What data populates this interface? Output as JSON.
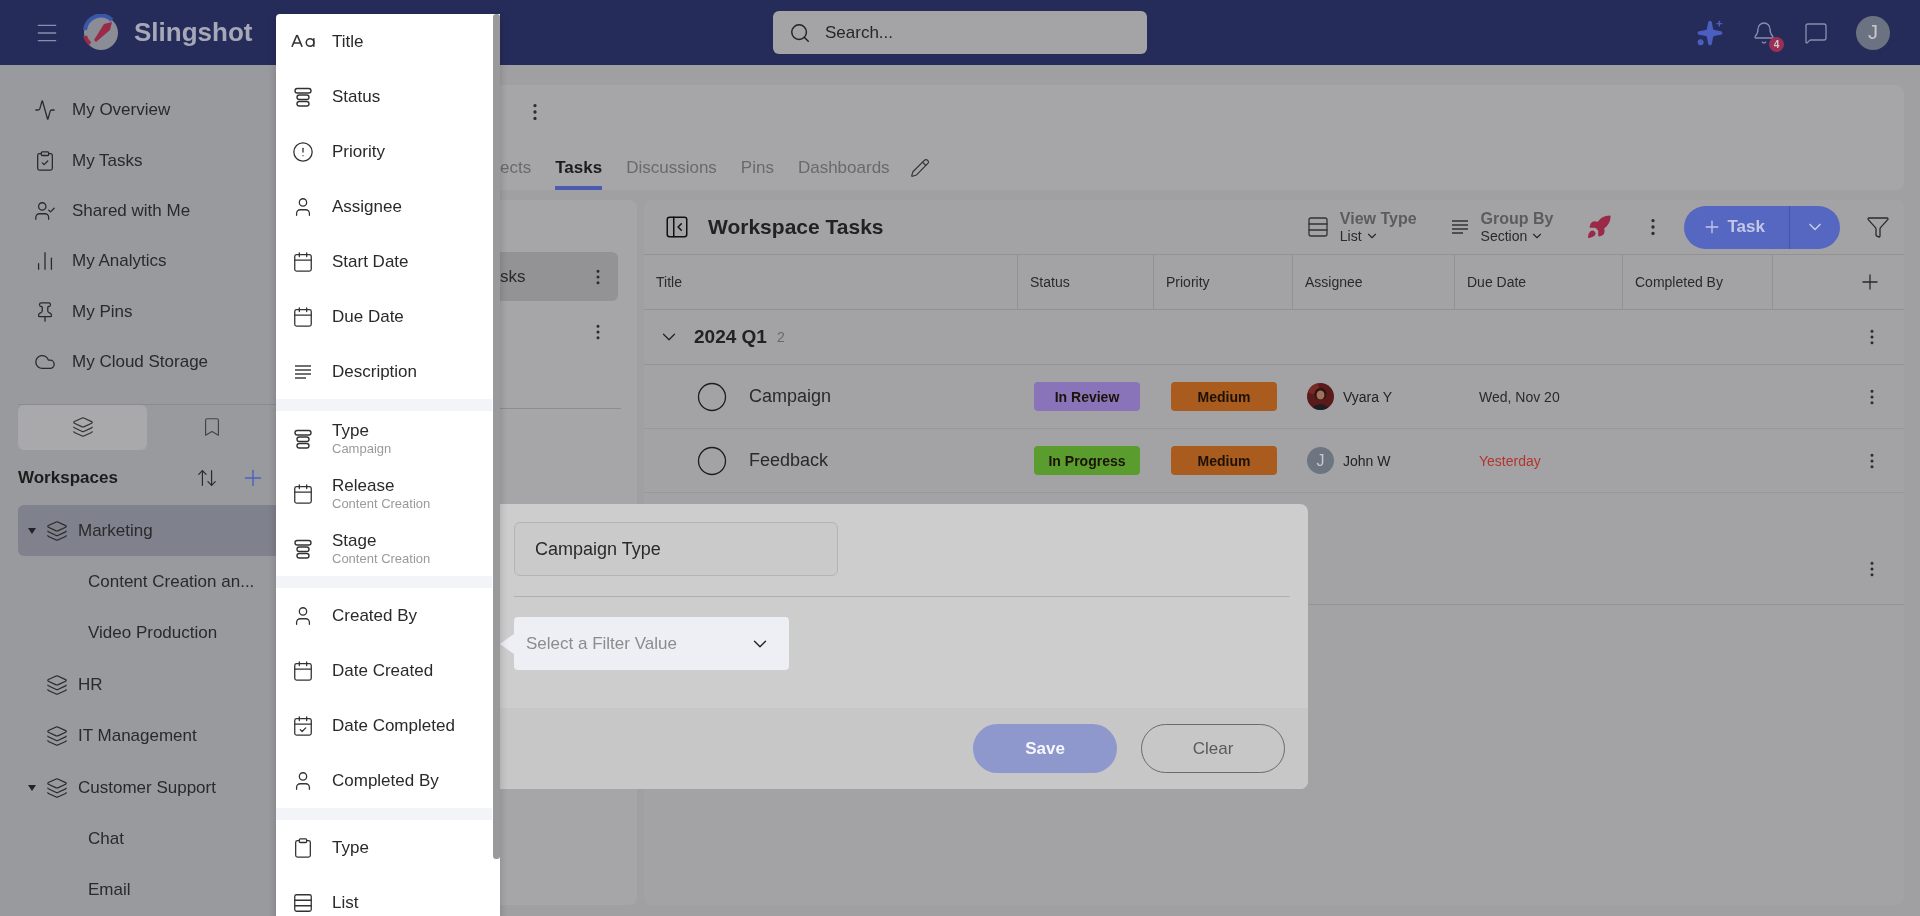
{
  "header": {
    "logo_text": "Slingshot",
    "search": {
      "placeholder": "Search..."
    },
    "notification_count": "4",
    "avatar_initial": "J"
  },
  "sidebar": {
    "nav": [
      {
        "label": "My Overview",
        "kind": "overview"
      },
      {
        "label": "My Tasks",
        "kind": "tasks"
      },
      {
        "label": "Shared with Me",
        "kind": "shared"
      },
      {
        "label": "My Analytics",
        "kind": "analytics"
      },
      {
        "label": "My Pins",
        "kind": "pins"
      },
      {
        "label": "My Cloud Storage",
        "kind": "cloud"
      }
    ],
    "tabs": [
      {
        "kind": "layers",
        "selected": true
      },
      {
        "kind": "bookmark",
        "selected": false
      }
    ],
    "workspaces_title": "Workspaces",
    "workspaces": [
      {
        "label": "Marketing",
        "selected": true,
        "expanded": true,
        "children": [
          {
            "label": "Content Creation an..."
          },
          {
            "label": "Video Production"
          }
        ]
      },
      {
        "label": "HR",
        "selected": false,
        "expanded": false
      },
      {
        "label": "IT Management",
        "selected": false,
        "expanded": false
      },
      {
        "label": "Customer Support",
        "selected": false,
        "expanded": true,
        "children": [
          {
            "label": "Chat"
          },
          {
            "label": "Email"
          }
        ]
      }
    ]
  },
  "project": {
    "tabs": [
      {
        "label": "ects",
        "selected": false
      },
      {
        "label": "Tasks",
        "selected": true
      },
      {
        "label": "Discussions",
        "selected": false
      },
      {
        "label": "Pins",
        "selected": false
      },
      {
        "label": "Dashboards",
        "selected": false
      }
    ]
  },
  "lists_panel": {
    "items": [
      {
        "label": "sks",
        "selected": true
      },
      {
        "selected": false
      }
    ]
  },
  "tasks_panel": {
    "title": "Workspace Tasks",
    "view_type": {
      "label": "View Type",
      "value": "List"
    },
    "group_by": {
      "label": "Group By",
      "value": "Section"
    },
    "add_button": "Task",
    "columns": [
      "Title",
      "Status",
      "Priority",
      "Assignee",
      "Due Date",
      "Completed By"
    ],
    "groups": [
      {
        "name": "2024 Q1",
        "count": "2",
        "expanded": true,
        "tasks": [
          {
            "title": "Campaign",
            "completed": false,
            "status": {
              "label": "In Review",
              "color": "#8a74b9"
            },
            "priority": {
              "label": "Medium",
              "color": "#a95c1d"
            },
            "assignee": {
              "name": "Vyara Y"
            },
            "due": "Wed, Nov 20",
            "overdue": false
          },
          {
            "title": "Feedback",
            "completed": false,
            "status": {
              "label": "In Progress",
              "color": "#5b9c2f"
            },
            "priority": {
              "label": "Medium",
              "color": "#a95c1d"
            },
            "assignee": {
              "name": "John W",
              "kind": "initial",
              "initial": "J"
            },
            "due": "Yesterday",
            "overdue": true
          }
        ]
      }
    ]
  },
  "filter_dialog": {
    "field_value": "Campaign Type",
    "select_placeholder": "Select a Filter Value",
    "buttons": [
      {
        "label": "Save",
        "kind": "primary",
        "disabled": true
      },
      {
        "label": "Clear",
        "kind": "outline",
        "disabled": false
      }
    ]
  },
  "field_menu": {
    "sections": [
      [
        {
          "label": "Title",
          "kind": "text"
        },
        {
          "label": "Status",
          "kind": "select"
        },
        {
          "label": "Priority",
          "kind": "priority"
        },
        {
          "label": "Assignee",
          "kind": "person"
        },
        {
          "label": "Start Date",
          "kind": "date"
        },
        {
          "label": "Due Date",
          "kind": "date"
        },
        {
          "label": "Description",
          "kind": "lines"
        }
      ],
      [
        {
          "label": "Type",
          "sublabel": "Campaign",
          "kind": "select"
        },
        {
          "label": "Release",
          "sublabel": "Content Creation",
          "kind": "date"
        },
        {
          "label": "Stage",
          "sublabel": "Content Creation",
          "kind": "select"
        }
      ],
      [
        {
          "label": "Created By",
          "kind": "person"
        },
        {
          "label": "Date Created",
          "kind": "date"
        },
        {
          "label": "Date Completed",
          "kind": "datecheck"
        },
        {
          "label": "Completed By",
          "kind": "person"
        }
      ],
      [
        {
          "label": "Type",
          "kind": "tag"
        },
        {
          "label": "List",
          "kind": "list"
        }
      ]
    ]
  }
}
